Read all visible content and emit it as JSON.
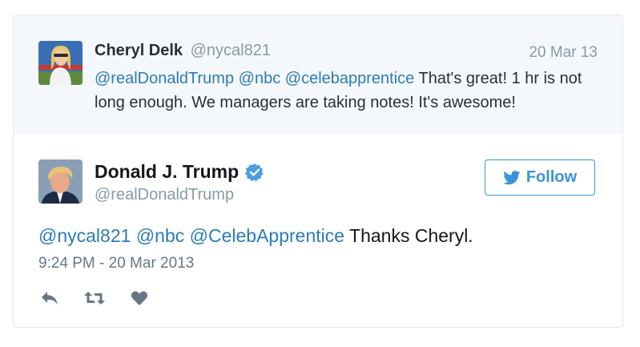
{
  "parent_tweet": {
    "name": "Cheryl Delk",
    "handle": "@nycal821",
    "date": "20 Mar 13",
    "mentions": [
      "@realDonaldTrump",
      "@nbc",
      "@celebapprentice"
    ],
    "text": "That's great! 1 hr is not long enough. We managers are taking notes! It's awesome!"
  },
  "main_tweet": {
    "name": "Donald J. Trump",
    "handle": "@realDonaldTrump",
    "verified_icon": "verified-badge-icon",
    "follow_label": "Follow",
    "mentions": [
      "@nycal821",
      "@nbc",
      "@CelebApprentice"
    ],
    "text": "Thanks Cheryl.",
    "timestamp": "9:24 PM - 20 Mar 2013"
  },
  "actions": [
    "reply-icon",
    "retweet-icon",
    "like-icon"
  ],
  "colors": {
    "link": "#2b7bb9",
    "follow": "#3b94d9",
    "muted": "#8899a6",
    "parent_bg": "#f5f8fa",
    "border": "#e1e8ed"
  }
}
